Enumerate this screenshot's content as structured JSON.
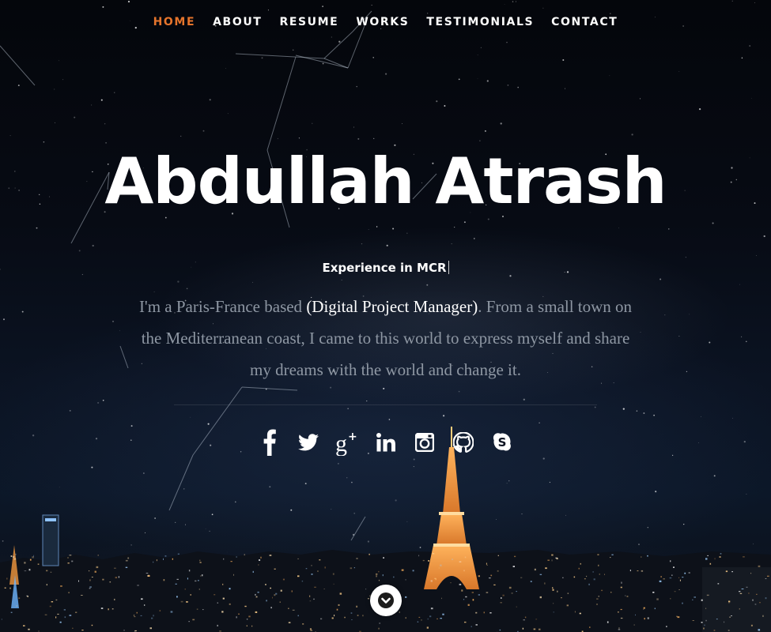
{
  "nav": {
    "items": [
      {
        "label": "HOME",
        "active": true
      },
      {
        "label": "ABOUT",
        "active": false
      },
      {
        "label": "RESUME",
        "active": false
      },
      {
        "label": "WORKS",
        "active": false
      },
      {
        "label": "TESTIMONIALS",
        "active": false
      },
      {
        "label": "CONTACT",
        "active": false
      }
    ],
    "active_color": "#e5742c"
  },
  "hero": {
    "name": "Abdullah Atrash",
    "subtitle": "Experience in MCR",
    "bio": {
      "before": "I'm a Paris-France based ",
      "highlight": "(Digital Project Manager)",
      "after": ". From a small town on the Mediterranean coast, I came to this world to express myself and share my dreams with the world and change it."
    }
  },
  "socials": [
    {
      "icon": "facebook-icon"
    },
    {
      "icon": "twitter-icon"
    },
    {
      "icon": "google-plus-icon"
    },
    {
      "icon": "linkedin-icon"
    },
    {
      "icon": "instagram-icon"
    },
    {
      "icon": "github-icon"
    },
    {
      "icon": "skype-icon"
    }
  ],
  "scroll_button": {
    "icon": "chevron-down-icon"
  }
}
